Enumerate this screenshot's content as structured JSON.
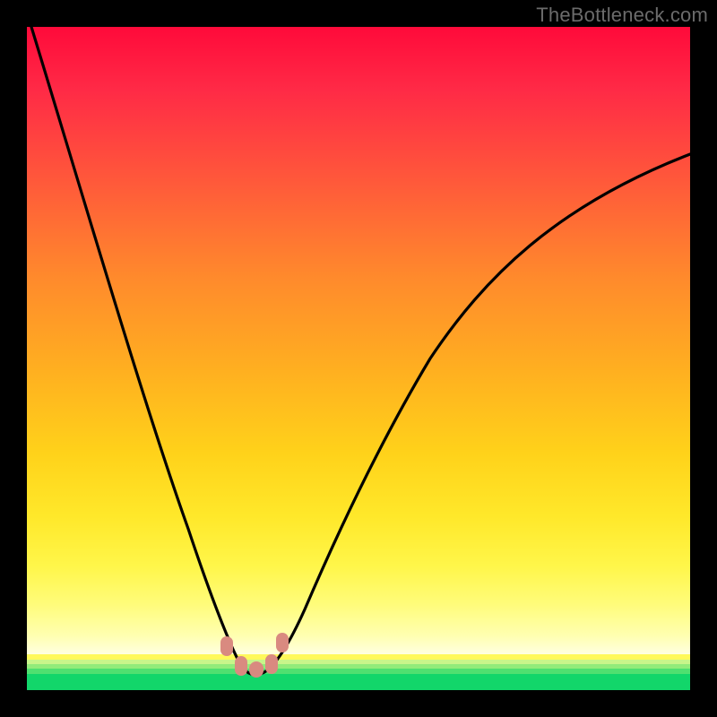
{
  "watermark": "TheBottleneck.com",
  "chart_data": {
    "type": "line",
    "title": "",
    "xlabel": "",
    "ylabel": "",
    "xlim": [
      0,
      100
    ],
    "ylim": [
      0,
      100
    ],
    "grid": false,
    "legend": false,
    "x": [
      0,
      2,
      5,
      8,
      11,
      14,
      17,
      20,
      22,
      24,
      26,
      27.5,
      29,
      30.5,
      31.5,
      32.5,
      33.5,
      35,
      36.5,
      38,
      40,
      43,
      46,
      50,
      55,
      60,
      66,
      72,
      79,
      86,
      93,
      100
    ],
    "values": [
      100,
      95,
      88,
      80,
      72,
      64,
      56,
      47,
      40,
      33,
      25,
      18,
      12,
      7,
      4,
      2.5,
      2.5,
      3.5,
      6,
      10,
      16,
      25,
      33,
      42,
      51,
      58,
      64,
      69,
      73,
      76.5,
      79,
      81
    ],
    "background_gradient_stops": [
      {
        "pos": 0.0,
        "color": "#ff0a3a"
      },
      {
        "pos": 0.4,
        "color": "#ff8a2c"
      },
      {
        "pos": 0.7,
        "color": "#ffd21a"
      },
      {
        "pos": 0.92,
        "color": "#fffc7a"
      },
      {
        "pos": 0.96,
        "color": "#c8f58a"
      },
      {
        "pos": 1.0,
        "color": "#12d66a"
      }
    ],
    "marker_color": "#d98a80",
    "markers": {
      "x": [
        28.5,
        30.5,
        32.5,
        34.5
      ],
      "y": [
        8,
        3,
        3,
        8
      ]
    }
  }
}
